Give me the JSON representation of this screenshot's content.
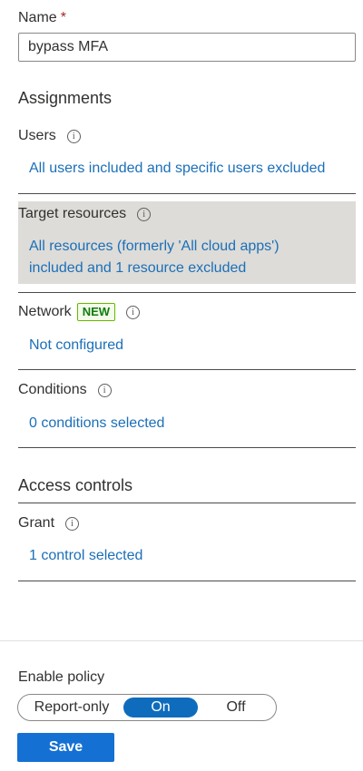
{
  "name_field": {
    "label": "Name",
    "required_mark": "*",
    "value": "bypass MFA"
  },
  "assignments": {
    "heading": "Assignments",
    "users": {
      "title": "Users",
      "link": "All users included and specific users excluded"
    },
    "target_resources": {
      "title": "Target resources",
      "link_line1": "All resources (formerly 'All cloud apps')",
      "link_line2": "included and 1 resource excluded"
    },
    "network": {
      "title": "Network",
      "badge": "NEW",
      "link": "Not configured"
    },
    "conditions": {
      "title": "Conditions",
      "link": "0 conditions selected"
    }
  },
  "access_controls": {
    "heading": "Access controls",
    "grant": {
      "title": "Grant",
      "link": "1 control selected"
    }
  },
  "enable_policy": {
    "label": "Enable policy",
    "options": [
      "Report-only",
      "On",
      "Off"
    ],
    "selected": "On"
  },
  "save_label": "Save",
  "info_glyph": "i",
  "colors": {
    "link": "#1b6fb8",
    "primary": "#1570d4",
    "toggle_on": "#0f6cbd",
    "selected_bg": "#dddcd8",
    "badge_green": "#107c10"
  }
}
